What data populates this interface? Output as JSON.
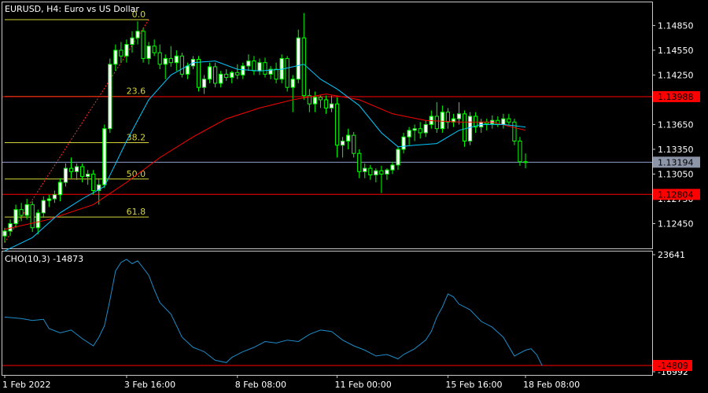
{
  "header": {
    "title": "EURUSD, H4:  Euro vs US Dollar"
  },
  "indicator": {
    "title": "CHO(10,3) -14873"
  },
  "colors": {
    "background": "#000000",
    "frame": "#c8c8c8",
    "candle": "#00ff00",
    "bull_body": "#ffffff",
    "bear_body": "#000000",
    "ma_fast": "#00c8ff",
    "ma_slow": "#ff0000",
    "fib": "#d4d43a",
    "level_line": "#ff0000",
    "current_line": "#8ca0c8",
    "cho_line": "#1e8cc8"
  },
  "chart_data": [
    {
      "type": "line",
      "name_key": "price",
      "y_ticks": [
        "1.14850",
        "1.14550",
        "1.14250",
        "1.13650",
        "1.13350",
        "1.13050",
        "1.12750",
        "1.12450"
      ],
      "ylim": [
        1.1215,
        1.1513
      ],
      "x_ticks": [
        "1 Feb 2022",
        "3 Feb 16:00",
        "8 Feb 08:00",
        "11 Feb 00:00",
        "15 Feb 16:00",
        "18 Feb 08:00"
      ],
      "price_labels": [
        {
          "value": "1.13988",
          "price": 1.13988,
          "kind": "level"
        },
        {
          "value": "1.13194",
          "price": 1.13194,
          "kind": "current"
        },
        {
          "value": "1.12804",
          "price": 1.12804,
          "kind": "level"
        }
      ],
      "fibonacci": {
        "levels": [
          {
            "label": "0.0",
            "price": 1.1492
          },
          {
            "label": "23.6",
            "price": 1.1399
          },
          {
            "label": "38.2",
            "price": 1.1343
          },
          {
            "label": "50.0",
            "price": 1.1299
          },
          {
            "label": "61.8",
            "price": 1.1253
          }
        ]
      },
      "candles": [
        [
          1.123,
          1.124,
          1.1222,
          1.1236
        ],
        [
          1.1236,
          1.125,
          1.123,
          1.1245
        ],
        [
          1.1245,
          1.1268,
          1.124,
          1.1262
        ],
        [
          1.1262,
          1.127,
          1.1248,
          1.1255
        ],
        [
          1.1255,
          1.1275,
          1.125,
          1.1268
        ],
        [
          1.1268,
          1.1272,
          1.1235,
          1.124
        ],
        [
          1.124,
          1.1262,
          1.1232,
          1.1258
        ],
        [
          1.1258,
          1.1278,
          1.1252,
          1.1273
        ],
        [
          1.1273,
          1.128,
          1.1265,
          1.1275
        ],
        [
          1.1275,
          1.1285,
          1.127,
          1.128
        ],
        [
          1.128,
          1.13,
          1.1272,
          1.1295
        ],
        [
          1.1295,
          1.1318,
          1.129,
          1.1312
        ],
        [
          1.1312,
          1.1325,
          1.13,
          1.1308
        ],
        [
          1.1308,
          1.1318,
          1.1298,
          1.1314
        ],
        [
          1.1314,
          1.1318,
          1.1295,
          1.1302
        ],
        [
          1.1302,
          1.131,
          1.1292,
          1.1305
        ],
        [
          1.1305,
          1.131,
          1.128,
          1.1285
        ],
        [
          1.1285,
          1.13,
          1.1268,
          1.1292
        ],
        [
          1.1292,
          1.1365,
          1.1288,
          1.136
        ],
        [
          1.136,
          1.1445,
          1.1355,
          1.1438
        ],
        [
          1.1438,
          1.1462,
          1.143,
          1.1455
        ],
        [
          1.1455,
          1.1465,
          1.144,
          1.1448
        ],
        [
          1.1448,
          1.1468,
          1.144,
          1.1462
        ],
        [
          1.1462,
          1.1478,
          1.1452,
          1.147
        ],
        [
          1.147,
          1.149,
          1.1462,
          1.1478
        ],
        [
          1.1478,
          1.1482,
          1.144,
          1.1445
        ],
        [
          1.1445,
          1.1465,
          1.1438,
          1.146
        ],
        [
          1.146,
          1.1468,
          1.1448,
          1.1452
        ],
        [
          1.1452,
          1.1462,
          1.1432,
          1.1438
        ],
        [
          1.1438,
          1.145,
          1.142,
          1.1445
        ],
        [
          1.1445,
          1.146,
          1.1435,
          1.144
        ],
        [
          1.144,
          1.1455,
          1.143,
          1.1448
        ],
        [
          1.1448,
          1.1452,
          1.1422,
          1.1426
        ],
        [
          1.1426,
          1.144,
          1.142,
          1.1436
        ],
        [
          1.1436,
          1.1448,
          1.1432,
          1.1444
        ],
        [
          1.1444,
          1.1448,
          1.1405,
          1.141
        ],
        [
          1.141,
          1.1425,
          1.1402,
          1.142
        ],
        [
          1.142,
          1.144,
          1.1415,
          1.1435
        ],
        [
          1.1435,
          1.144,
          1.141,
          1.1415
        ],
        [
          1.1415,
          1.143,
          1.141,
          1.1426
        ],
        [
          1.1426,
          1.1432,
          1.1418,
          1.1422
        ],
        [
          1.1422,
          1.143,
          1.1415,
          1.1428
        ],
        [
          1.1428,
          1.1438,
          1.142,
          1.1425
        ],
        [
          1.1425,
          1.144,
          1.142,
          1.1436
        ],
        [
          1.1436,
          1.145,
          1.143,
          1.1442
        ],
        [
          1.1442,
          1.1448,
          1.1425,
          1.143
        ],
        [
          1.143,
          1.1445,
          1.1425,
          1.144
        ],
        [
          1.144,
          1.1446,
          1.1422,
          1.1426
        ],
        [
          1.1426,
          1.1436,
          1.142,
          1.1432
        ],
        [
          1.1432,
          1.144,
          1.1415,
          1.142
        ],
        [
          1.142,
          1.145,
          1.1415,
          1.1445
        ],
        [
          1.1445,
          1.1448,
          1.1405,
          1.141
        ],
        [
          1.141,
          1.1425,
          1.138,
          1.142
        ],
        [
          1.142,
          1.148,
          1.1415,
          1.147
        ],
        [
          1.147,
          1.15,
          1.1395,
          1.14
        ],
        [
          1.14,
          1.1408,
          1.138,
          1.139
        ],
        [
          1.139,
          1.1405,
          1.138,
          1.1398
        ],
        [
          1.1398,
          1.14,
          1.1385,
          1.1395
        ],
        [
          1.1395,
          1.14,
          1.1378,
          1.1385
        ],
        [
          1.1385,
          1.14,
          1.138,
          1.139
        ],
        [
          1.139,
          1.1398,
          1.1325,
          1.134
        ],
        [
          1.134,
          1.135,
          1.1325,
          1.1345
        ],
        [
          1.1345,
          1.136,
          1.1335,
          1.1352
        ],
        [
          1.1352,
          1.1356,
          1.1325,
          1.133
        ],
        [
          1.133,
          1.1335,
          1.13,
          1.1308
        ],
        [
          1.1308,
          1.1318,
          1.13,
          1.1312
        ],
        [
          1.1312,
          1.1316,
          1.1298,
          1.1304
        ],
        [
          1.1304,
          1.1312,
          1.1295,
          1.1309
        ],
        [
          1.1309,
          1.1315,
          1.1282,
          1.1305
        ],
        [
          1.1305,
          1.1312,
          1.1298,
          1.131
        ],
        [
          1.131,
          1.132,
          1.1305,
          1.1316
        ],
        [
          1.1316,
          1.1338,
          1.131,
          1.1335
        ],
        [
          1.1335,
          1.1355,
          1.133,
          1.135
        ],
        [
          1.135,
          1.1362,
          1.134,
          1.1358
        ],
        [
          1.1358,
          1.1365,
          1.1345,
          1.136
        ],
        [
          1.136,
          1.1368,
          1.1348,
          1.1355
        ],
        [
          1.1355,
          1.137,
          1.135,
          1.1365
        ],
        [
          1.1365,
          1.1382,
          1.136,
          1.1375
        ],
        [
          1.1375,
          1.1392,
          1.1355,
          1.136
        ],
        [
          1.136,
          1.1388,
          1.1355,
          1.138
        ],
        [
          1.138,
          1.1385,
          1.136,
          1.1368
        ],
        [
          1.1368,
          1.1378,
          1.1362,
          1.1372
        ],
        [
          1.1372,
          1.1392,
          1.1365,
          1.1378
        ],
        [
          1.1378,
          1.1382,
          1.1338,
          1.1345
        ],
        [
          1.1345,
          1.138,
          1.134,
          1.1375
        ],
        [
          1.1375,
          1.138,
          1.1355,
          1.1362
        ],
        [
          1.1362,
          1.1372,
          1.1355,
          1.1368
        ],
        [
          1.1368,
          1.1372,
          1.1358,
          1.1366
        ],
        [
          1.1366,
          1.1376,
          1.136,
          1.137
        ],
        [
          1.137,
          1.1375,
          1.1362,
          1.1365
        ],
        [
          1.1365,
          1.1378,
          1.136,
          1.1372
        ],
        [
          1.1372,
          1.1378,
          1.1365,
          1.1368
        ],
        [
          1.1368,
          1.1372,
          1.134,
          1.1345
        ],
        [
          1.1345,
          1.135,
          1.1315,
          1.132
        ],
        [
          1.132,
          1.133,
          1.1312,
          1.1319
        ]
      ],
      "ma_fast": [
        [
          0,
          1.1212
        ],
        [
          5,
          1.1228
        ],
        [
          10,
          1.1258
        ],
        [
          14,
          1.1275
        ],
        [
          18,
          1.129
        ],
        [
          22,
          1.1345
        ],
        [
          26,
          1.1395
        ],
        [
          30,
          1.1425
        ],
        [
          34,
          1.144
        ],
        [
          38,
          1.1442
        ],
        [
          42,
          1.1432
        ],
        [
          46,
          1.143
        ],
        [
          50,
          1.1432
        ],
        [
          54,
          1.1438
        ],
        [
          57,
          1.142
        ],
        [
          60,
          1.1408
        ],
        [
          64,
          1.1388
        ],
        [
          68,
          1.1355
        ],
        [
          71,
          1.1338
        ],
        [
          74,
          1.134
        ],
        [
          78,
          1.1342
        ],
        [
          82,
          1.1358
        ],
        [
          86,
          1.1365
        ],
        [
          90,
          1.1365
        ],
        [
          94,
          1.1362
        ]
      ],
      "ma_slow": [
        [
          0,
          1.1238
        ],
        [
          8,
          1.125
        ],
        [
          16,
          1.1268
        ],
        [
          22,
          1.1295
        ],
        [
          28,
          1.1325
        ],
        [
          34,
          1.135
        ],
        [
          40,
          1.1372
        ],
        [
          46,
          1.1385
        ],
        [
          52,
          1.1395
        ],
        [
          58,
          1.1402
        ],
        [
          64,
          1.1395
        ],
        [
          70,
          1.1378
        ],
        [
          76,
          1.137
        ],
        [
          82,
          1.1368
        ],
        [
          88,
          1.1368
        ],
        [
          94,
          1.1358
        ]
      ]
    },
    {
      "type": "line",
      "name_key": "cho",
      "y_ticks": [
        "23641",
        "-16992"
      ],
      "ylim": [
        -16992,
        23641
      ],
      "cho_level": {
        "value": "-14809",
        "level": -14809
      },
      "values": [
        [
          0,
          2000
        ],
        [
          3,
          1500
        ],
        [
          5,
          800
        ],
        [
          7,
          1200
        ],
        [
          8,
          -2000
        ],
        [
          10,
          -3500
        ],
        [
          12,
          -2500
        ],
        [
          14,
          -5500
        ],
        [
          16,
          -8000
        ],
        [
          17,
          -5000
        ],
        [
          18,
          -1000
        ],
        [
          19,
          8000
        ],
        [
          20,
          18000
        ],
        [
          21,
          21000
        ],
        [
          22,
          22000
        ],
        [
          23,
          20500
        ],
        [
          24,
          21500
        ],
        [
          25,
          19000
        ],
        [
          26,
          16500
        ],
        [
          27,
          11500
        ],
        [
          28,
          7000
        ],
        [
          30,
          3000
        ],
        [
          32,
          -5000
        ],
        [
          34,
          -8500
        ],
        [
          36,
          -10000
        ],
        [
          38,
          -13000
        ],
        [
          40,
          -13800
        ],
        [
          41,
          -12000
        ],
        [
          43,
          -10000
        ],
        [
          45,
          -8500
        ],
        [
          47,
          -6500
        ],
        [
          49,
          -7000
        ],
        [
          51,
          -6000
        ],
        [
          53,
          -6500
        ],
        [
          55,
          -4000
        ],
        [
          57,
          -2500
        ],
        [
          59,
          -3000
        ],
        [
          61,
          -6000
        ],
        [
          63,
          -8000
        ],
        [
          65,
          -9500
        ],
        [
          67,
          -11500
        ],
        [
          69,
          -11000
        ],
        [
          71,
          -12500
        ],
        [
          72,
          -11000
        ],
        [
          74,
          -9000
        ],
        [
          76,
          -6000
        ],
        [
          77,
          -3000
        ],
        [
          78,
          2000
        ],
        [
          79,
          5500
        ],
        [
          80,
          10000
        ],
        [
          81,
          9000
        ],
        [
          82,
          6500
        ],
        [
          84,
          4500
        ],
        [
          86,
          500
        ],
        [
          88,
          -1500
        ],
        [
          90,
          -5000
        ],
        [
          92,
          -11500
        ],
        [
          93,
          -10500
        ],
        [
          94,
          -9500
        ],
        [
          95,
          -9000
        ],
        [
          96,
          -11000
        ],
        [
          97,
          -14800
        ]
      ]
    }
  ]
}
